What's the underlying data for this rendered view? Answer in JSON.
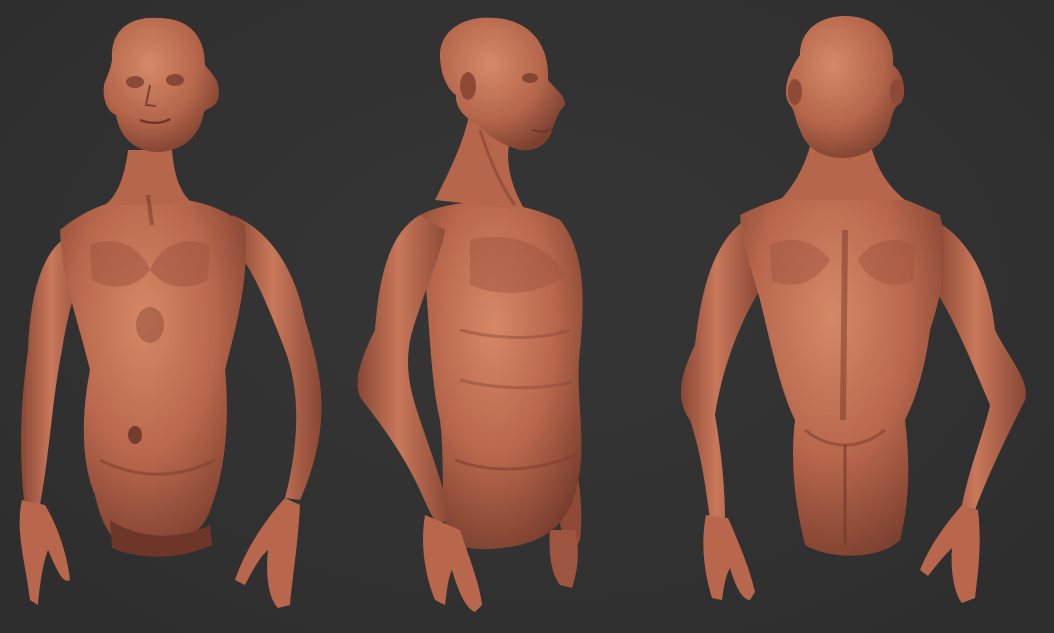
{
  "scene": {
    "background_color": "#323232",
    "skin_light": "#c97a5c",
    "skin_mid": "#b0624a",
    "skin_dark": "#7e4030",
    "skin_shadow": "#5e2e22"
  },
  "views": [
    {
      "name": "front-view"
    },
    {
      "name": "three-quarter-view"
    },
    {
      "name": "back-view"
    }
  ]
}
